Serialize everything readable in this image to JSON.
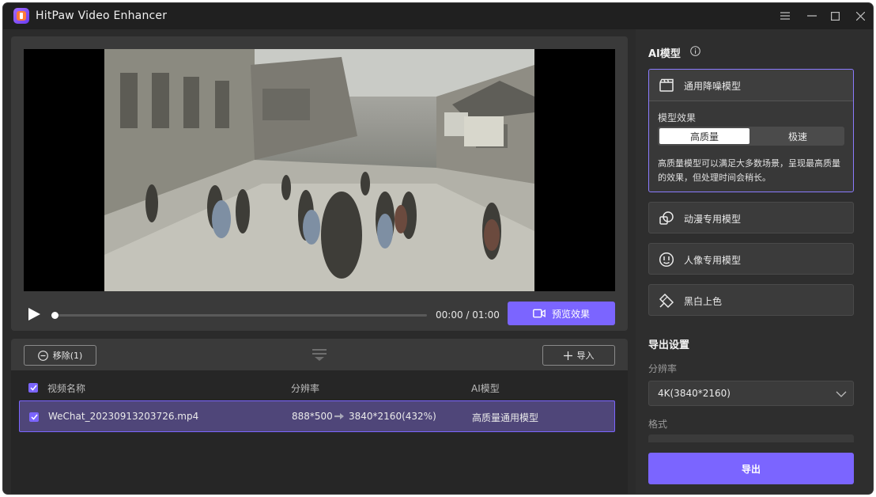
{
  "app": {
    "title": "HitPaw Video Enhancer"
  },
  "player": {
    "time_text": "00:00 / 01:00",
    "progress": 0.0,
    "preview_label": "预览效果"
  },
  "file_list": {
    "remove_label": "移除(1)",
    "import_label": "导入",
    "columns": {
      "name": "视频名称",
      "resolution": "分辨率",
      "model": "AI模型"
    },
    "rows": [
      {
        "name": "WeChat_20230913203726.mp4",
        "source_res": "888*500",
        "target_res": "3840*2160(432%)",
        "model": "高质量通用模型"
      }
    ]
  },
  "ai_models": {
    "title": "AI模型",
    "selected": {
      "label": "通用降噪模型",
      "effect_label": "模型效果",
      "options": [
        "高质量",
        "极速"
      ],
      "selected_option": "高质量",
      "description": "高质量模型可以满足大多数场景，呈现最高质量的效果，但处理时间会稍长。"
    },
    "others": [
      {
        "label": "动漫专用模型",
        "icon": "anime-model-icon"
      },
      {
        "label": "人像专用模型",
        "icon": "face-model-icon"
      },
      {
        "label": "黑白上色",
        "icon": "colorize-icon"
      }
    ]
  },
  "export": {
    "title": "导出设置",
    "resolution_label": "分辨率",
    "resolution_value": "4K(3840*2160)",
    "format_label": "格式",
    "button_label": "导出"
  },
  "colors": {
    "accent": "#7b65ff",
    "selected_row": "#4f4679",
    "panel": "#3a3a3a",
    "background": "#2b2b2b"
  }
}
